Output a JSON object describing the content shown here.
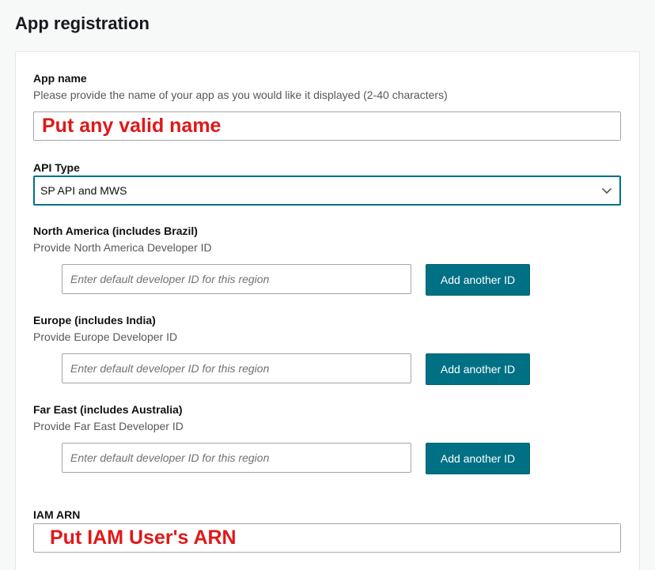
{
  "page": {
    "title": "App registration"
  },
  "app_name": {
    "label": "App name",
    "hint": "Please provide the name of your app as you would like it displayed (2-40 characters)",
    "value": "Put any valid name"
  },
  "api_type": {
    "label": "API Type",
    "selected": "SP API and MWS"
  },
  "regions": [
    {
      "label": "North America (includes Brazil)",
      "hint": "Provide North America Developer ID",
      "placeholder": "Enter default developer ID for this region",
      "button": "Add another ID"
    },
    {
      "label": "Europe (includes India)",
      "hint": "Provide Europe Developer ID",
      "placeholder": "Enter default developer ID for this region",
      "button": "Add another ID"
    },
    {
      "label": "Far East (includes Australia)",
      "hint": "Provide Far East Developer ID",
      "placeholder": "Enter default developer ID for this region",
      "button": "Add another ID"
    }
  ],
  "iam_arn": {
    "label": "IAM ARN",
    "value": "Put IAM User's ARN"
  },
  "colors": {
    "accent": "#007185",
    "annotation_red": "#e01818"
  },
  "icons": {
    "select_arrow": "chevron-down-icon"
  }
}
